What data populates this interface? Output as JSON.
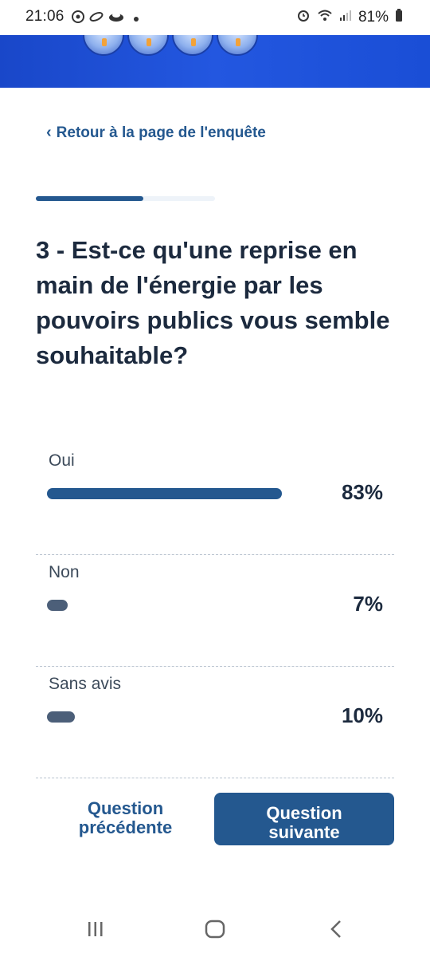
{
  "status_bar": {
    "time": "21:06",
    "battery": "81%",
    "left_icons": [
      "chrome-icon",
      "app-icon",
      "cloud-icon"
    ],
    "right_icons": [
      "alarm-icon",
      "wifi-icon",
      "signal-icon",
      "battery-icon"
    ]
  },
  "page": {
    "back_link": "Retour à la page de l'enquête",
    "progress_fraction": 0.6,
    "question": "3 - Est-ce qu'une reprise en main de l'énergie par les pouvoirs publics vous semble souhaitable?"
  },
  "results": [
    {
      "label": "Oui",
      "percent_label": "83%",
      "value": 83,
      "bar_color": "#24588f"
    },
    {
      "label": "Non",
      "percent_label": "7%",
      "value": 7,
      "bar_color": "#4c5f79"
    },
    {
      "label": "Sans avis",
      "percent_label": "10%",
      "value": 10,
      "bar_color": "#4c5f79"
    }
  ],
  "buttons": {
    "previous": "Question précédente",
    "next": "Question suivante"
  },
  "colors": {
    "accent": "#24588f",
    "banner": "#1f50d8",
    "text": "#1c2a3e"
  }
}
